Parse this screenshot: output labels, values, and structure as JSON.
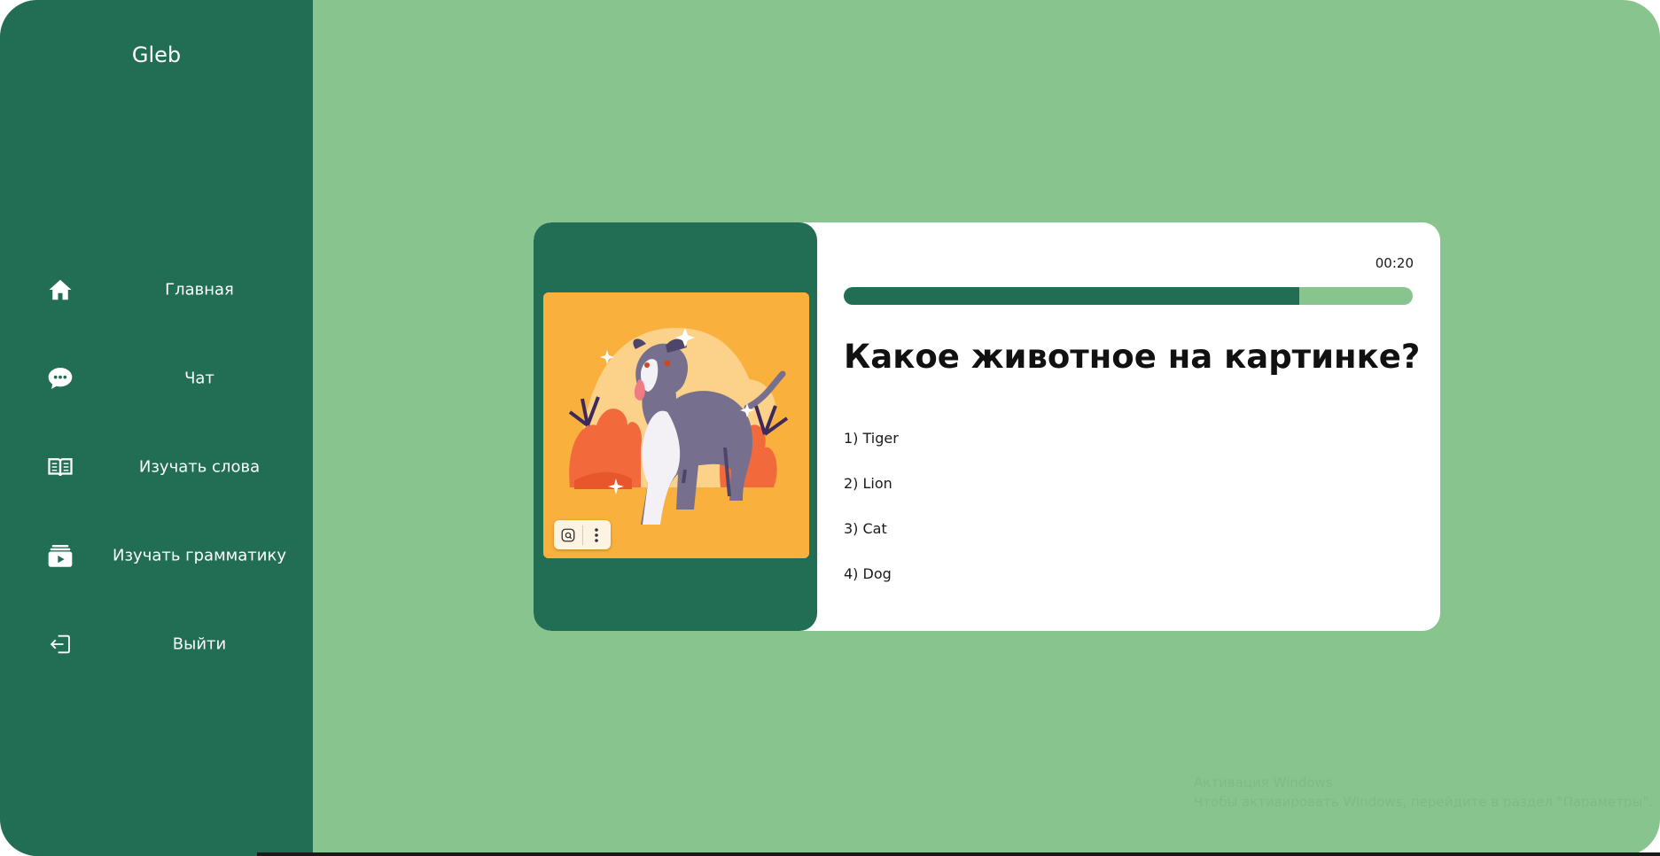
{
  "sidebar": {
    "user_name": "Gleb",
    "items": [
      {
        "label": "Главная",
        "icon": "home-icon"
      },
      {
        "label": "Чат",
        "icon": "chat-icon"
      },
      {
        "label": "Изучать слова",
        "icon": "book-icon"
      },
      {
        "label": "Изучать грамматику",
        "icon": "video-lesson-icon"
      },
      {
        "label": "Выйти",
        "icon": "logout-icon"
      }
    ]
  },
  "quiz": {
    "timer": "00:20",
    "progress": 0.8,
    "question": "Какое животное на картинке?",
    "answers": [
      "1) Tiger",
      "2) Lion",
      "3) Cat",
      "4) Dog"
    ],
    "image": "dog-illustration"
  },
  "watermark": {
    "line1": "Активация Windows",
    "line2": "Чтобы активировать Windows, перейдите в раздел \"Параметры\"."
  },
  "colors": {
    "sidebar": "#226e54",
    "background": "#88c48e",
    "card": "#ffffff",
    "image_bg": "#f9b03d"
  }
}
